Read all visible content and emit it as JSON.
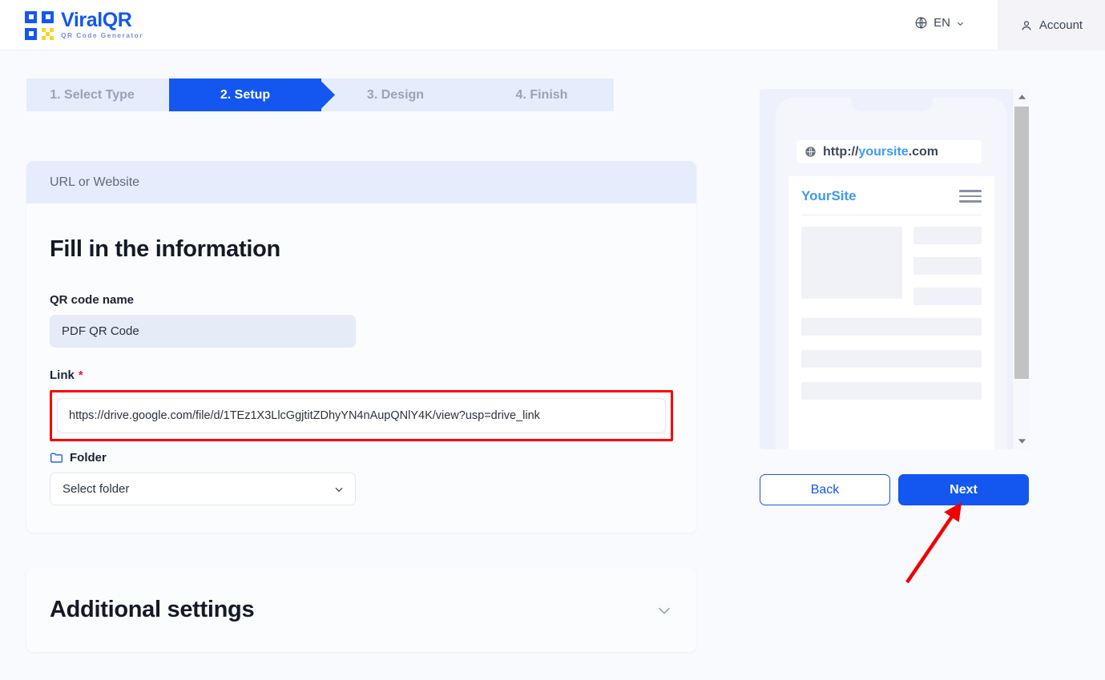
{
  "header": {
    "logo_name": "ViralQR",
    "logo_tagline": "QR Code Generator",
    "language": "EN",
    "account_label": "Account",
    "brand_color": "#1357f0",
    "accent_color": "#ffd21e"
  },
  "stepper": {
    "steps": [
      {
        "label": "1. Select Type",
        "active": false
      },
      {
        "label": "2. Setup",
        "active": true
      },
      {
        "label": "3. Design",
        "active": false
      },
      {
        "label": "4. Finish",
        "active": false
      }
    ],
    "active_color": "#1357f0",
    "inactive_color": "#e5ecfb"
  },
  "form": {
    "card_header": "URL or Website",
    "title": "Fill in the information",
    "name_field": {
      "label": "QR code name",
      "value": "PDF QR Code"
    },
    "link_field": {
      "label": "Link",
      "required_mark": "*",
      "value": "https://drive.google.com/file/d/1TEz1X3LlcGgjtitZDhyYN4nAupQNlY4K/view?usp=drive_link",
      "highlight_color": "#ff0000"
    },
    "folder_field": {
      "label": "Folder",
      "placeholder": "Select folder"
    }
  },
  "additional": {
    "title": "Additional settings"
  },
  "preview": {
    "url_scheme": "http://",
    "url_host": "yoursite",
    "url_tld": ".com",
    "site_brand": "YourSite"
  },
  "nav": {
    "back_label": "Back",
    "next_label": "Next"
  }
}
